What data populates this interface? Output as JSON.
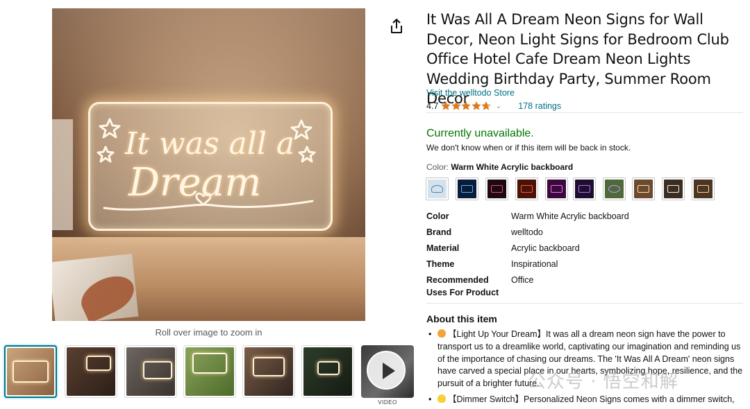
{
  "product": {
    "title": "It Was All A Dream Neon Signs for Wall Decor, Neon Light Signs for Bedroom Club Office Hotel Cafe Dream Neon Lights Wedding Birthday Party, Summer Room Decor",
    "store_link": "Visit the welltodo Store",
    "rating_value": "4.7",
    "ratings_count": "178 ratings",
    "stars_fraction": 0.94
  },
  "gallery": {
    "roll_over_text": "Roll over image to zoom in",
    "video_label": "VIDEO",
    "sign_text": "It was all a Dream"
  },
  "availability": {
    "status": "Currently unavailable.",
    "note": "We don't know when or if this item will be back in stock."
  },
  "color": {
    "label": "Color: ",
    "selected": "Warm White Acrylic backboard"
  },
  "specs": [
    {
      "key": "Color",
      "value": "Warm White Acrylic backboard"
    },
    {
      "key": "Brand",
      "value": "welltodo"
    },
    {
      "key": "Material",
      "value": "Acrylic backboard"
    },
    {
      "key": "Theme",
      "value": "Inspirational"
    },
    {
      "key": "Recommended Uses For Product",
      "value": "Office"
    }
  ],
  "about": {
    "title": "About this item",
    "bullets": [
      "【Light Up Your Dream】It was all a dream neon sign have the power to transport us to a dreamlike world, captivating our imagination and reminding us of the importance of chasing our dreams. The 'It Was All A Dream' neon signs have carved a special place in our hearts, symbolizing hope, resilience, and the pursuit of a brighter future.",
      "【Dimmer Switch】Personalized Neon Signs comes with a dimmer switch,"
    ]
  },
  "watermark": "公众号 · 悟空和解",
  "colors": {
    "link": "#007185",
    "available_green": "#007600",
    "selected_thumb_border": "#007185",
    "star": "#de7921"
  }
}
